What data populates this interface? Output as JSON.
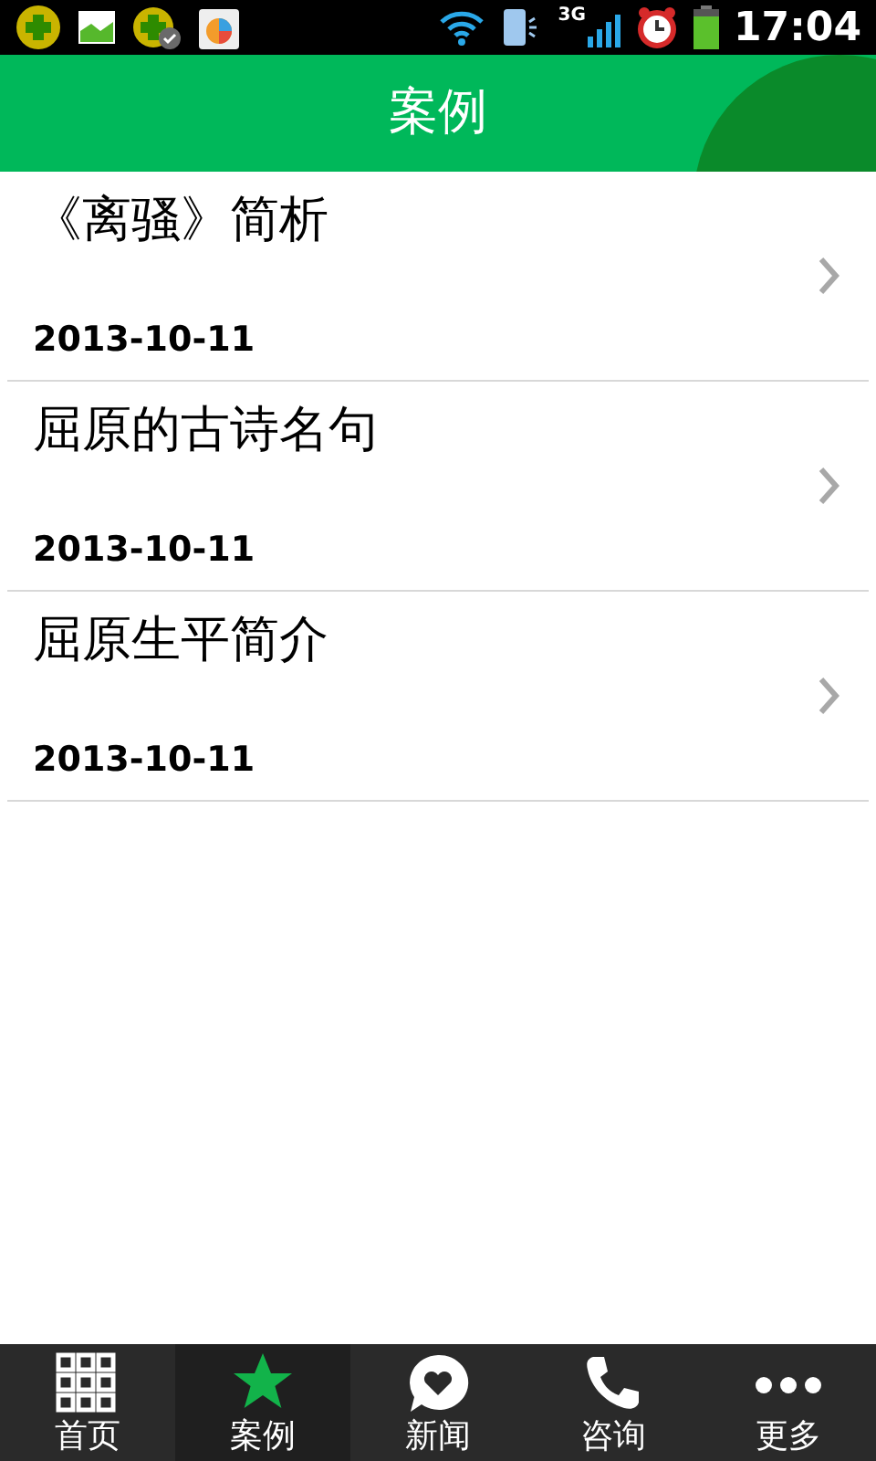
{
  "status_bar": {
    "time": "17:04",
    "network": "3G"
  },
  "header": {
    "title": "案例"
  },
  "articles": [
    {
      "title": "《离骚》简析",
      "date": "2013-10-11"
    },
    {
      "title": "屈原的古诗名句",
      "date": "2013-10-11"
    },
    {
      "title": "屈原生平简介",
      "date": "2013-10-11"
    }
  ],
  "tabs": [
    {
      "label": "首页",
      "selected": false
    },
    {
      "label": "案例",
      "selected": true
    },
    {
      "label": "新闻",
      "selected": false
    },
    {
      "label": "咨询",
      "selected": false
    },
    {
      "label": "更多",
      "selected": false
    }
  ]
}
